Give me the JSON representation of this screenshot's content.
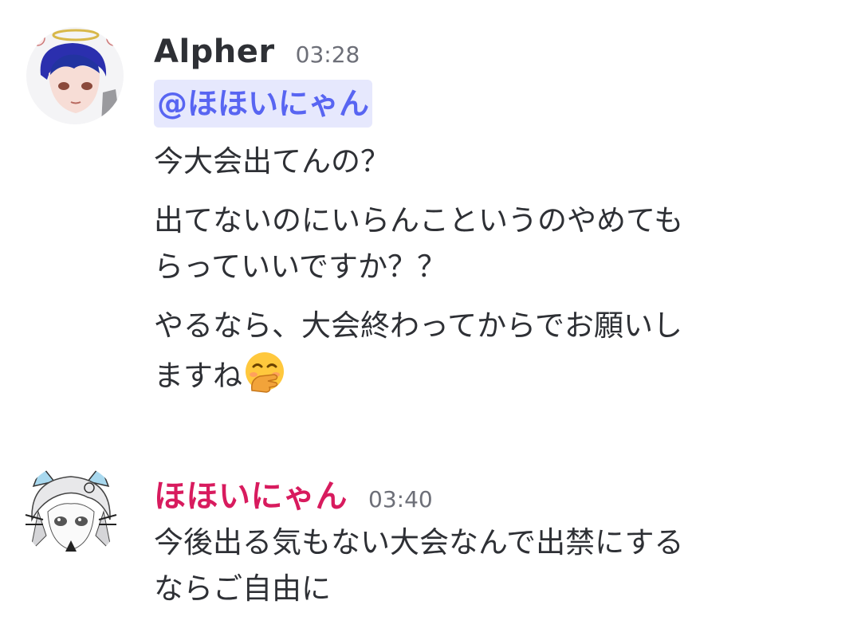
{
  "messages": [
    {
      "author": "Alpher",
      "author_color": "#2e3035",
      "timestamp": "03:28",
      "mention": "@ほほいにゃん",
      "lines": [
        "今大会出てんの？",
        "出てないのにいらんこというのやめても",
        "らっていいですか？？",
        "やるなら、大会終わってからでお願いし",
        "ますね"
      ],
      "emoji": "face-with-hand-over-mouth"
    },
    {
      "author": "ほほいにゃん",
      "author_color": "#d81b5e",
      "timestamp": "03:40",
      "lines": [
        "今後出る気もない大会なんで出禁にする",
        "ならご自由に"
      ]
    }
  ],
  "colors": {
    "mention_bg": "#e6e8fd",
    "mention_text": "#5865f2",
    "timestamp": "#6d6f78",
    "text": "#2e3035"
  }
}
